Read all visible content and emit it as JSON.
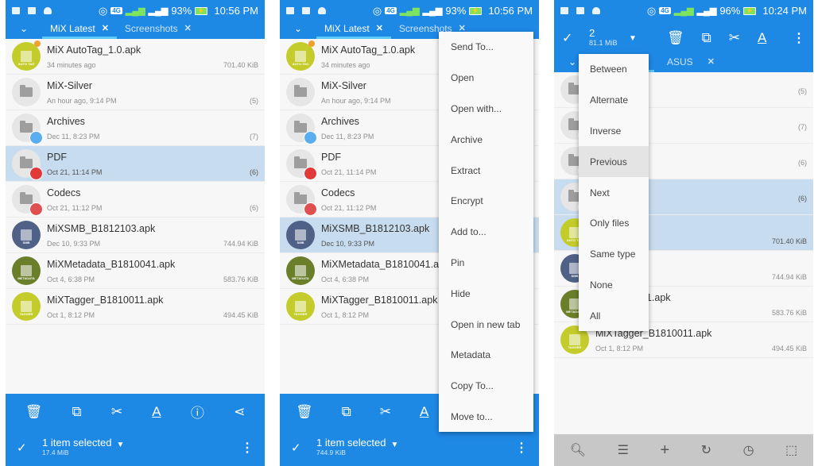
{
  "colors": {
    "primary": "#1e88e5",
    "selected_row": "#c7dcef",
    "tab_indicator": "#5cc8f5"
  },
  "panels": [
    {
      "status": {
        "battery": "93%",
        "time": "10:56 PM"
      },
      "tabs": [
        {
          "label": "MiX Latest",
          "active": true
        },
        {
          "label": "Screenshots",
          "active": false
        }
      ],
      "rows": [
        {
          "name": "MiX AutoTag_1.0.apk",
          "meta": "34 minutes ago",
          "size": "701.40 KiB",
          "type": "apk",
          "icon_color": "#c4cc2c",
          "icon_label": "AUTO TAG",
          "selected": false
        },
        {
          "name": "MiX-Silver",
          "meta": "An hour ago, 9:14 PM",
          "size": "(5)",
          "type": "folder",
          "selected": false
        },
        {
          "name": "Archives",
          "meta": "Dec 11, 8:23 PM",
          "size": "(7)",
          "type": "folder",
          "badge_color": "#5aaef0",
          "selected": false
        },
        {
          "name": "PDF",
          "meta": "Oct 21, 11:14 PM",
          "size": "(6)",
          "type": "folder",
          "badge_color": "#e03a3a",
          "selected": true
        },
        {
          "name": "Codecs",
          "meta": "Oct 21, 11:12 PM",
          "size": "(6)",
          "type": "folder",
          "badge_color": "#e05050",
          "selected": false
        },
        {
          "name": "MiXSMB_B1812103.apk",
          "meta": "Dec 10, 9:33 PM",
          "size": "744.94 KiB",
          "type": "apk",
          "icon_color": "#4f6186",
          "icon_label": "SMB",
          "selected": false
        },
        {
          "name": "MiXMetadata_B1810041.apk",
          "meta": "Oct 4, 6:38 PM",
          "size": "583.76 KiB",
          "type": "apk",
          "icon_color": "#6b7f2a",
          "icon_label": "METADATA",
          "selected": false
        },
        {
          "name": "MiXTagger_B1810011.apk",
          "meta": "Oct 1, 8:12 PM",
          "size": "494.45 KiB",
          "type": "apk",
          "icon_color": "#c4cc2c",
          "icon_label": "TAGGER",
          "selected": false
        }
      ],
      "bottom": {
        "selection_label": "1 item selected",
        "selection_size": "17.4 MiB",
        "icons": [
          "delete-icon",
          "copy-icon",
          "cut-icon",
          "rename-icon",
          "info-icon",
          "share-icon"
        ]
      }
    },
    {
      "status": {
        "battery": "93%",
        "time": "10:56 PM"
      },
      "tabs": [
        {
          "label": "MiX Latest",
          "active": true
        },
        {
          "label": "Screenshots",
          "active": false
        }
      ],
      "rows": [
        {
          "name": "MiX AutoTag_1.0.apk",
          "meta": "34 minutes ago",
          "size": "",
          "type": "apk",
          "icon_color": "#c4cc2c",
          "icon_label": "AUTO TAG",
          "selected": false
        },
        {
          "name": "MiX-Silver",
          "meta": "An hour ago, 9:14 PM",
          "size": "",
          "type": "folder",
          "selected": false
        },
        {
          "name": "Archives",
          "meta": "Dec 11, 8:23 PM",
          "size": "",
          "type": "folder",
          "badge_color": "#5aaef0",
          "selected": false
        },
        {
          "name": "PDF",
          "meta": "Oct 21, 11:14 PM",
          "size": "",
          "type": "folder",
          "badge_color": "#e03a3a",
          "selected": false
        },
        {
          "name": "Codecs",
          "meta": "Oct 21, 11:12 PM",
          "size": "",
          "type": "folder",
          "badge_color": "#e05050",
          "selected": false
        },
        {
          "name": "MiXSMB_B1812103.apk",
          "meta": "Dec 10, 9:33 PM",
          "size": "",
          "type": "apk",
          "icon_color": "#4f6186",
          "icon_label": "SMB",
          "selected": true
        },
        {
          "name": "MiXMetadata_B1810041.apk",
          "meta": "Oct 4, 6:38 PM",
          "size": "",
          "type": "apk",
          "icon_color": "#6b7f2a",
          "icon_label": "METADATA",
          "selected": false
        },
        {
          "name": "MiXTagger_B1810011.apk",
          "meta": "Oct 1, 8:12 PM",
          "size": "",
          "type": "apk",
          "icon_color": "#c4cc2c",
          "icon_label": "TAGGER",
          "selected": false
        }
      ],
      "context_menu": [
        "Send To...",
        "Open",
        "Open with...",
        "Archive",
        "Extract",
        "Encrypt",
        "Add to...",
        "Pin",
        "Hide",
        "Open in new tab",
        "Metadata",
        "Copy To...",
        "Move to..."
      ],
      "bottom": {
        "selection_label": "1 item selected",
        "selection_size": "744.9 KiB",
        "icons": [
          "delete-icon",
          "copy-icon",
          "cut-icon",
          "rename-icon"
        ]
      }
    },
    {
      "status": {
        "battery": "96%",
        "time": "10:24 PM"
      },
      "action": {
        "count": "2",
        "size": "81.1 MiB"
      },
      "tabs": [
        {
          "label": "",
          "active": true
        },
        {
          "label": "ASUS",
          "active": false
        }
      ],
      "rows": [
        {
          "name": "",
          "meta": "4 PM",
          "size": "(5)",
          "type": "folder",
          "selected": false
        },
        {
          "name": "",
          "meta": "",
          "size": "(7)",
          "type": "folder",
          "badge_color": "#5aaef0",
          "selected": false
        },
        {
          "name": "",
          "meta": "",
          "size": "(6)",
          "type": "folder",
          "badge_color": "#e03a3a",
          "selected": false
        },
        {
          "name": "",
          "meta": "",
          "size": "(6)",
          "type": "folder",
          "badge_color": "#e05050",
          "selected": true
        },
        {
          "name": "g_1.0.apk",
          "meta": "",
          "size": "701.40 KiB",
          "type": "apk",
          "icon_color": "#c4cc2c",
          "icon_label": "AUTO TAG",
          "selected": true
        },
        {
          "name": "812103.apk",
          "meta": "",
          "size": "744.94 KiB",
          "type": "apk",
          "icon_color": "#4f6186",
          "icon_label": "SMB",
          "selected": false
        },
        {
          "name": "a_B1810041.apk",
          "meta": "",
          "size": "583.76 KiB",
          "type": "apk",
          "icon_color": "#6b7f2a",
          "icon_label": "METADATA",
          "selected": false
        },
        {
          "name": "MiXTagger_B1810011.apk",
          "meta": "Oct 1, 8:12 PM",
          "size": "494.45 KiB",
          "type": "apk",
          "icon_color": "#c4cc2c",
          "icon_label": "TAGGER",
          "selected": false
        }
      ],
      "select_menu": [
        "Between",
        "Alternate",
        "Inverse",
        "Previous",
        "Next",
        "Only files",
        "Same type",
        "None",
        "All"
      ],
      "select_menu_highlighted": "Previous",
      "toolbar": [
        "search-icon",
        "list-view-icon",
        "add-icon",
        "refresh-icon",
        "history-icon",
        "select-area-icon"
      ]
    }
  ]
}
